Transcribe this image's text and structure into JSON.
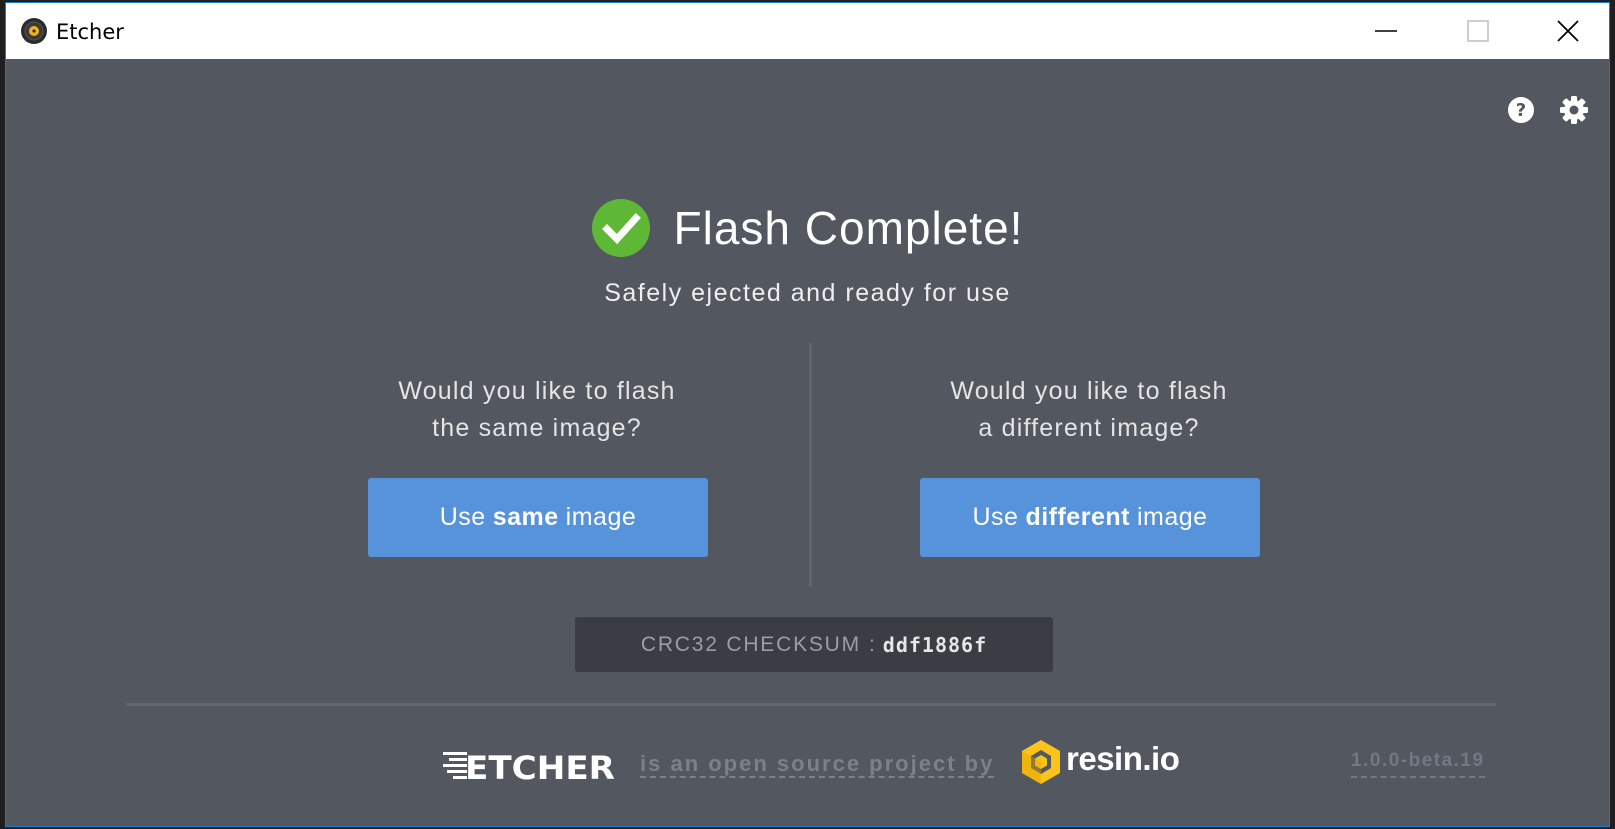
{
  "window": {
    "title": "Etcher"
  },
  "header": {
    "title": "Flash Complete!",
    "subtitle": "Safely ejected and ready for use"
  },
  "left_panel": {
    "question_line1": "Would you like to flash",
    "question_line2": "the same image?",
    "button_prefix": "Use",
    "button_bold": "same",
    "button_suffix": "image"
  },
  "right_panel": {
    "question_line1": "Would you like to flash",
    "question_line2": "a different image?",
    "button_prefix": "Use",
    "button_bold": "different",
    "button_suffix": "image"
  },
  "checksum": {
    "label": "CRC32 CHECKSUM",
    "separator": ":",
    "value": "ddf1886f"
  },
  "footer": {
    "etcher_logo_text": "ETCHER",
    "text": "is an open source project by",
    "resin_text": "resin.io",
    "version": "1.0.0-beta.19"
  },
  "icons": {
    "help": "help-icon",
    "settings": "gear-icon",
    "success": "check-circle-icon"
  },
  "colors": {
    "background": "#535760",
    "accent_button": "#5793db",
    "success": "#5fb835",
    "resin_yellow": "#fcc41b"
  }
}
